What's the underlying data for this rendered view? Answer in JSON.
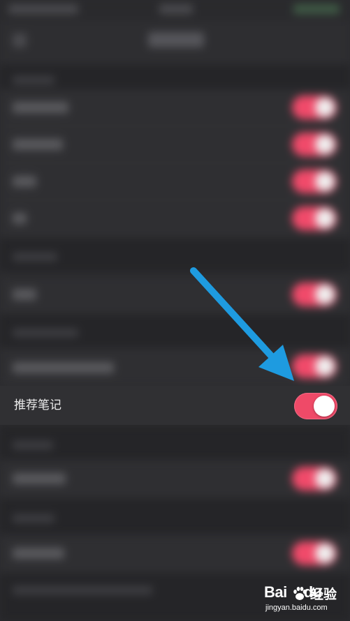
{
  "setting": {
    "label": "推荐笔记",
    "enabled": true
  },
  "watermark": {
    "brand_en_a": "Bai",
    "brand_en_b": "du",
    "brand_cn": "经验",
    "url": "jingyan.baidu.com"
  },
  "colors": {
    "background": "#2b2b2e",
    "row": "#303033",
    "toggle_on": "#ef4a68",
    "knob": "#ffffff",
    "arrow": "#1e9be0",
    "label_text": "#ececec"
  },
  "icons": {
    "arrow": "pointer-arrow-icon",
    "paw": "baidu-paw-icon"
  }
}
